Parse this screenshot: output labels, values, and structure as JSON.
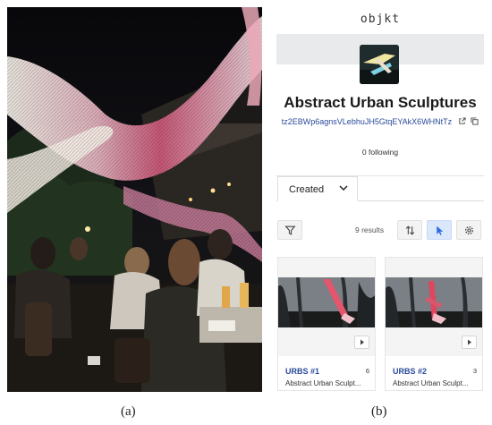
{
  "captions": {
    "a": "(a)",
    "b": "(b)"
  },
  "app": {
    "brand": "objkt"
  },
  "collection": {
    "title": "Abstract Urban Sculptures",
    "address": "tz2EBWp6agnsVLebhuJH5GtqEYAkX6WHNtTz",
    "following": "0 following"
  },
  "tabs": {
    "active": "Created"
  },
  "toolbar": {
    "results": "9 results"
  },
  "cards": [
    {
      "name": "URBS #1",
      "count": "6",
      "desc": "Abstract Urban Sculpt..."
    },
    {
      "name": "URBS #2",
      "count": "3",
      "desc": "Abstract Urban Sculpt..."
    }
  ],
  "colors": {
    "link": "#2a4a9a",
    "active_filter": "#dbe7fb",
    "active_icon": "#2d6be0"
  }
}
